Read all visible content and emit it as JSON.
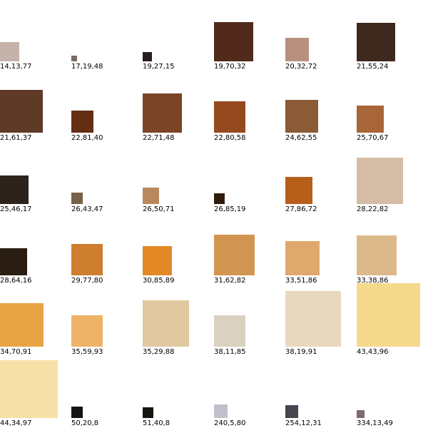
{
  "swatches": [
    {
      "label": "14,13,77",
      "color": "#c5b3ab",
      "size": 0.27
    },
    {
      "label": "17,19,48",
      "color": "#7b6b63",
      "size": 0.08
    },
    {
      "label": "19,27,15",
      "color": "#261e1c",
      "size": 0.13
    },
    {
      "label": "19,70,32",
      "color": "#522a1b",
      "size": 0.55
    },
    {
      "label": "20,32,72",
      "color": "#b8917e",
      "size": 0.33
    },
    {
      "label": "21,55,24",
      "color": "#3e291e",
      "size": 0.54
    },
    {
      "label": "21,61,37",
      "color": "#5f3b27",
      "size": 0.6
    },
    {
      "label": "22,81,40",
      "color": "#652e14",
      "size": 0.31
    },
    {
      "label": "22,71,48",
      "color": "#7c4427",
      "size": 0.55
    },
    {
      "label": "22,80,58",
      "color": "#95491e",
      "size": 0.44
    },
    {
      "label": "24,62,55",
      "color": "#8b5a36",
      "size": 0.46
    },
    {
      "label": "25,70,67",
      "color": "#a86537",
      "size": 0.38
    },
    {
      "label": "25,46,17",
      "color": "#2e231a",
      "size": 0.4
    },
    {
      "label": "26,43,47",
      "color": "#776148",
      "size": 0.16
    },
    {
      "label": "26,50,71",
      "color": "#b7895c",
      "size": 0.23
    },
    {
      "label": "26,85,19",
      "color": "#2e1b0b",
      "size": 0.15
    },
    {
      "label": "27,86,72",
      "color": "#b85e1b",
      "size": 0.38
    },
    {
      "label": "28,22,82",
      "color": "#d4bca5",
      "size": 0.65
    },
    {
      "label": "28,64,16",
      "color": "#2a1d12",
      "size": 0.38
    },
    {
      "label": "29,77,80",
      "color": "#cd7e2e",
      "size": 0.44
    },
    {
      "label": "30,85,89",
      "color": "#e38825",
      "size": 0.41
    },
    {
      "label": "31,62,82",
      "color": "#d29551",
      "size": 0.57
    },
    {
      "label": "33,51,86",
      "color": "#dfa86c",
      "size": 0.48
    },
    {
      "label": "33,38,86",
      "color": "#ddb98a",
      "size": 0.56
    },
    {
      "label": "34,70,91",
      "color": "#e8a444",
      "size": 0.61
    },
    {
      "label": "35,59,93",
      "color": "#eeb366",
      "size": 0.44
    },
    {
      "label": "35,29,88",
      "color": "#e0c8a0",
      "size": 0.65
    },
    {
      "label": "38,11,85",
      "color": "#d9d1c2",
      "size": 0.44
    },
    {
      "label": "38,19,91",
      "color": "#e8d9be",
      "size": 0.78
    },
    {
      "label": "43,43,96",
      "color": "#f5d98c",
      "size": 0.89
    },
    {
      "label": "44,34,97",
      "color": "#f7e0a8",
      "size": 0.81
    },
    {
      "label": "50,20,8",
      "color": "#161513",
      "size": 0.16
    },
    {
      "label": "51,40,8",
      "color": "#161511",
      "size": 0.15
    },
    {
      "label": "240,5,80",
      "color": "#c1c1cb",
      "size": 0.19
    },
    {
      "label": "254,12,31",
      "color": "#47464f",
      "size": 0.18
    },
    {
      "label": "334,13,49",
      "color": "#7e6a71",
      "size": 0.11
    }
  ]
}
